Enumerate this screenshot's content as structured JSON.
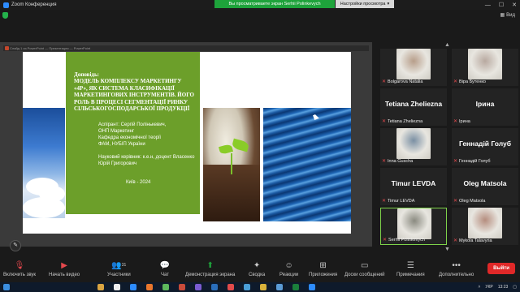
{
  "window": {
    "title": "Zoom Конференция",
    "share_banner": "Вы просматриваете экран Serhii Polinkevych",
    "view_options": "Настройки просмотра",
    "view_button": "Вид"
  },
  "share": {
    "ppt_title": "Слайд 1 из PowerPoint — Презентация — PowerPoint",
    "slide": {
      "heading_label": "Доповідь:",
      "heading": "МОДЕЛЬ КОМПЛЕКСУ МАРКЕТИНГУ «4Р», ЯК СИСТЕМА КЛАСИФІКАЦІЇ МАРКЕТИНГОВИХ ІНСТРУМЕНТІВ. ЙОГО РОЛЬ В ПРОЦЕСІ СЕГМЕНТАЦІЇ РИНКУ СІЛЬСЬКОГОСПОДАРСЬКОЇ ПРОДУКЦІЇ",
      "author_lines": [
        "Аспірант: Сергій Полінькевич,",
        "ОНП Маркетинг",
        "Кафедра економічної теорії",
        "ФАМ, НУБІП України"
      ],
      "supervisor_lines": [
        "Науковий керівник: к.е.н, доцент Власенко",
        "Юрій Григорович"
      ],
      "city_year": "Київ - 2024"
    }
  },
  "gallery": {
    "tiles": [
      {
        "name": "Bolgarova Natalia",
        "big": "",
        "photo": true,
        "color": "#b79e8a"
      },
      {
        "name": "Віра Бутенко",
        "big": "",
        "photo": true,
        "color": "#b8a9a0"
      },
      {
        "name": "Tetiana Zheliezna",
        "big": "Tetiana Zheliezna",
        "photo": false
      },
      {
        "name": "Ірина",
        "big": "Ірина",
        "photo": false
      },
      {
        "name": "Inna Guscha",
        "big": "",
        "photo": true,
        "color": "#7a8fa3"
      },
      {
        "name": "Геннадій Голуб",
        "big": "Геннадій Голуб",
        "photo": false
      },
      {
        "name": "Timur LEVDA",
        "big": "Timur LEVDA",
        "photo": false
      },
      {
        "name": "Oleg Matsola",
        "big": "Oleg Matsola",
        "photo": false
      },
      {
        "name": "Serhii Polinkevych",
        "big": "",
        "photo": true,
        "color": "#8a8a80"
      },
      {
        "name": "Mykola Talavyria",
        "big": "",
        "photo": true,
        "color": "#b58d7e"
      }
    ]
  },
  "toolbar": {
    "mute": "Включить звук",
    "video": "Начать видео",
    "participants": "Участники",
    "participants_count": "31",
    "chat": "Чат",
    "share": "Демонстрация экрана",
    "record": "Сводка",
    "reactions": "Реакции",
    "apps": "Приложения",
    "whiteboards": "Доски сообщений",
    "notes": "Примечания",
    "more": "Дополнительно",
    "leave": "Выйти"
  },
  "taskbar": {
    "lang": "УКР",
    "time": "13:23"
  },
  "colors": {
    "accent_green": "#1ea33b",
    "leave_red": "#e02828",
    "slide_green": "#6c9f2a"
  }
}
